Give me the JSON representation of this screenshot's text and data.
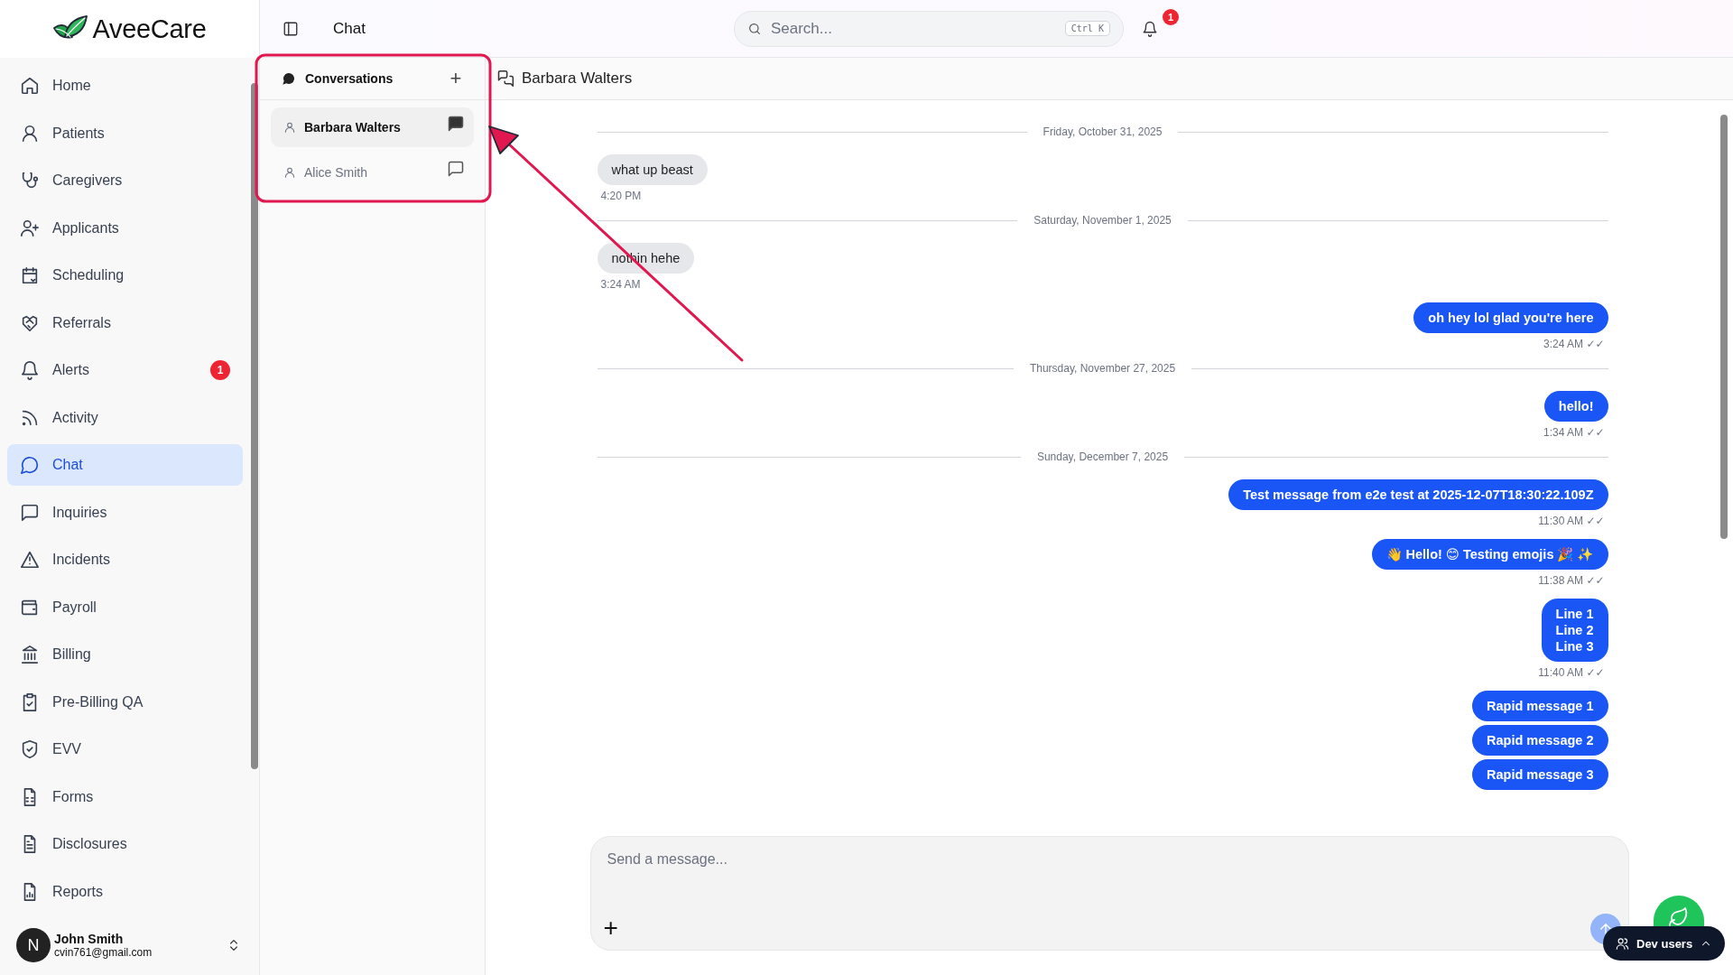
{
  "brand": {
    "name": "AveeCare"
  },
  "sidebar": {
    "items": [
      {
        "label": "Home",
        "selected": false
      },
      {
        "label": "Patients",
        "selected": false
      },
      {
        "label": "Caregivers",
        "selected": false
      },
      {
        "label": "Applicants",
        "selected": false
      },
      {
        "label": "Scheduling",
        "selected": false
      },
      {
        "label": "Referrals",
        "selected": false
      },
      {
        "label": "Alerts",
        "selected": false,
        "badge": "1"
      },
      {
        "label": "Activity",
        "selected": false
      },
      {
        "label": "Chat",
        "selected": true
      },
      {
        "label": "Inquiries",
        "selected": false
      },
      {
        "label": "Incidents",
        "selected": false
      },
      {
        "label": "Payroll",
        "selected": false
      },
      {
        "label": "Billing",
        "selected": false
      },
      {
        "label": "Pre-Billing QA",
        "selected": false
      },
      {
        "label": "EVV",
        "selected": false
      },
      {
        "label": "Forms",
        "selected": false
      },
      {
        "label": "Disclosures",
        "selected": false
      },
      {
        "label": "Reports",
        "selected": false
      }
    ],
    "user": {
      "initial": "N",
      "name": "John Smith",
      "email": "cvin761@gmail.com"
    }
  },
  "topbar": {
    "title": "Chat",
    "search": {
      "placeholder": "Search...",
      "shortcut": "Ctrl K"
    },
    "notifications": "1"
  },
  "conversations": {
    "title": "Conversations",
    "plus": "+",
    "items": [
      {
        "name": "Barbara Walters",
        "selected": true
      },
      {
        "name": "Alice Smith",
        "selected": false
      }
    ]
  },
  "chat": {
    "title": "Barbara Walters",
    "messages": [
      {
        "kind": "date",
        "text": "Friday, October 31, 2025"
      },
      {
        "kind": "received",
        "text": "what up beast",
        "time": "4:20 PM"
      },
      {
        "kind": "date",
        "text": "Saturday, November 1, 2025"
      },
      {
        "kind": "received",
        "text": "nothin hehe",
        "time": "3:24 AM"
      },
      {
        "kind": "sent",
        "text": "oh hey lol glad you're here",
        "time": "3:24 AM ✓✓"
      },
      {
        "kind": "date",
        "text": "Thursday, November 27, 2025"
      },
      {
        "kind": "sent",
        "text": "hello!",
        "time": "1:34 AM ✓✓"
      },
      {
        "kind": "date",
        "text": "Sunday, December 7, 2025"
      },
      {
        "kind": "sent",
        "text": "Test message from e2e test at 2025-12-07T18:30:22.109Z",
        "time": "11:30 AM ✓✓"
      },
      {
        "kind": "sent",
        "text": "👋 Hello! 😊 Testing emojis 🎉 ✨",
        "time": "11:38 AM ✓✓"
      },
      {
        "kind": "sent",
        "text": "Line 1\nLine 2\nLine 3",
        "time": "11:40 AM ✓✓"
      },
      {
        "kind": "sent",
        "text": "Rapid message 1"
      },
      {
        "kind": "sent",
        "text": "Rapid message 2"
      },
      {
        "kind": "sent",
        "text": "Rapid message 3"
      }
    ],
    "composer": {
      "placeholder": "Send a message...",
      "plus": "+"
    }
  },
  "dev_users": {
    "label": "Dev users"
  }
}
